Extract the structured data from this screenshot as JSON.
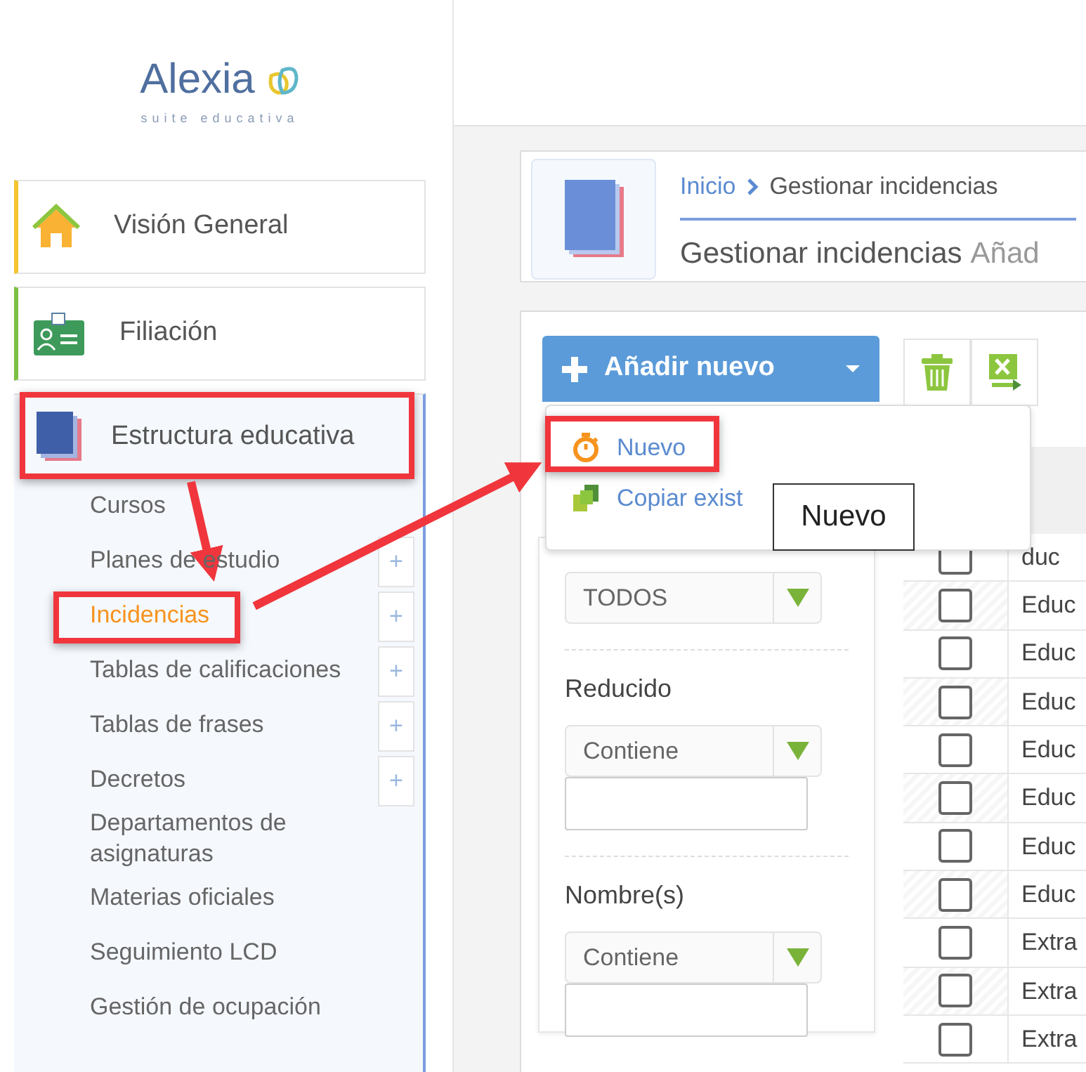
{
  "logo": {
    "name": "Alexia",
    "tagline": "suite educativa"
  },
  "sidebar": {
    "items": [
      {
        "label": "Visión General",
        "color": "#f4c430",
        "highlighted": false
      },
      {
        "label": "Filiación",
        "color": "#7cc142",
        "highlighted": false
      },
      {
        "label": "Estructura educativa",
        "highlighted": true,
        "children": [
          {
            "label": "Cursos",
            "selected": false,
            "highlighted": false
          },
          {
            "label": "Planes de estudio",
            "selected": false,
            "add_label": "+",
            "highlighted": false
          },
          {
            "label": "Incidencias",
            "selected": true,
            "add_label": "+",
            "highlighted": true
          },
          {
            "label": "Tablas de calificaciones",
            "selected": false,
            "add_label": "+",
            "highlighted": false
          },
          {
            "label": "Tablas de frases",
            "selected": false,
            "add_label": "+",
            "highlighted": false
          },
          {
            "label": "Decretos",
            "selected": false,
            "add_label": "+",
            "highlighted": false
          },
          {
            "label": "Departamentos de asignaturas",
            "selected": false,
            "highlighted": false
          },
          {
            "label": "Materias oficiales",
            "selected": false,
            "highlighted": false
          },
          {
            "label": "Seguimiento LCD",
            "selected": false,
            "highlighted": false
          },
          {
            "label": "Gestión de ocupación",
            "selected": false,
            "highlighted": false
          }
        ]
      }
    ]
  },
  "breadcrumb": [
    "Inicio",
    "Gestionar incidencias"
  ],
  "page_title": "Gestionar incidencias",
  "page_subtitle": "Añad",
  "add_button": {
    "label": "Añadir nuevo"
  },
  "add_menu": [
    {
      "label": "Nuevo",
      "highlighted": true
    },
    {
      "label": "Copiar exist",
      "highlighted": false
    }
  ],
  "tooltip": "Nuevo",
  "filters": [
    {
      "kind": "select",
      "value": "TODOS"
    },
    {
      "kind": "text",
      "label": "Reducido",
      "operator": "Contiene"
    },
    {
      "kind": "text",
      "label": "Nombre(s)",
      "operator": "Contiene"
    }
  ],
  "table": {
    "rows": [
      {
        "checked": false,
        "column_2": "duc"
      },
      {
        "checked": false,
        "column_2": "Educ"
      },
      {
        "checked": false,
        "column_2": "Educ"
      },
      {
        "checked": false,
        "column_2": "Educ"
      },
      {
        "checked": false,
        "column_2": "Educ"
      },
      {
        "checked": false,
        "column_2": "Educ"
      },
      {
        "checked": false,
        "column_2": "Educ"
      },
      {
        "checked": false,
        "column_2": "Educ"
      },
      {
        "checked": false,
        "column_2": "Extra"
      },
      {
        "checked": false,
        "column_2": "Extra"
      },
      {
        "checked": false,
        "column_2": "Extra"
      }
    ]
  }
}
